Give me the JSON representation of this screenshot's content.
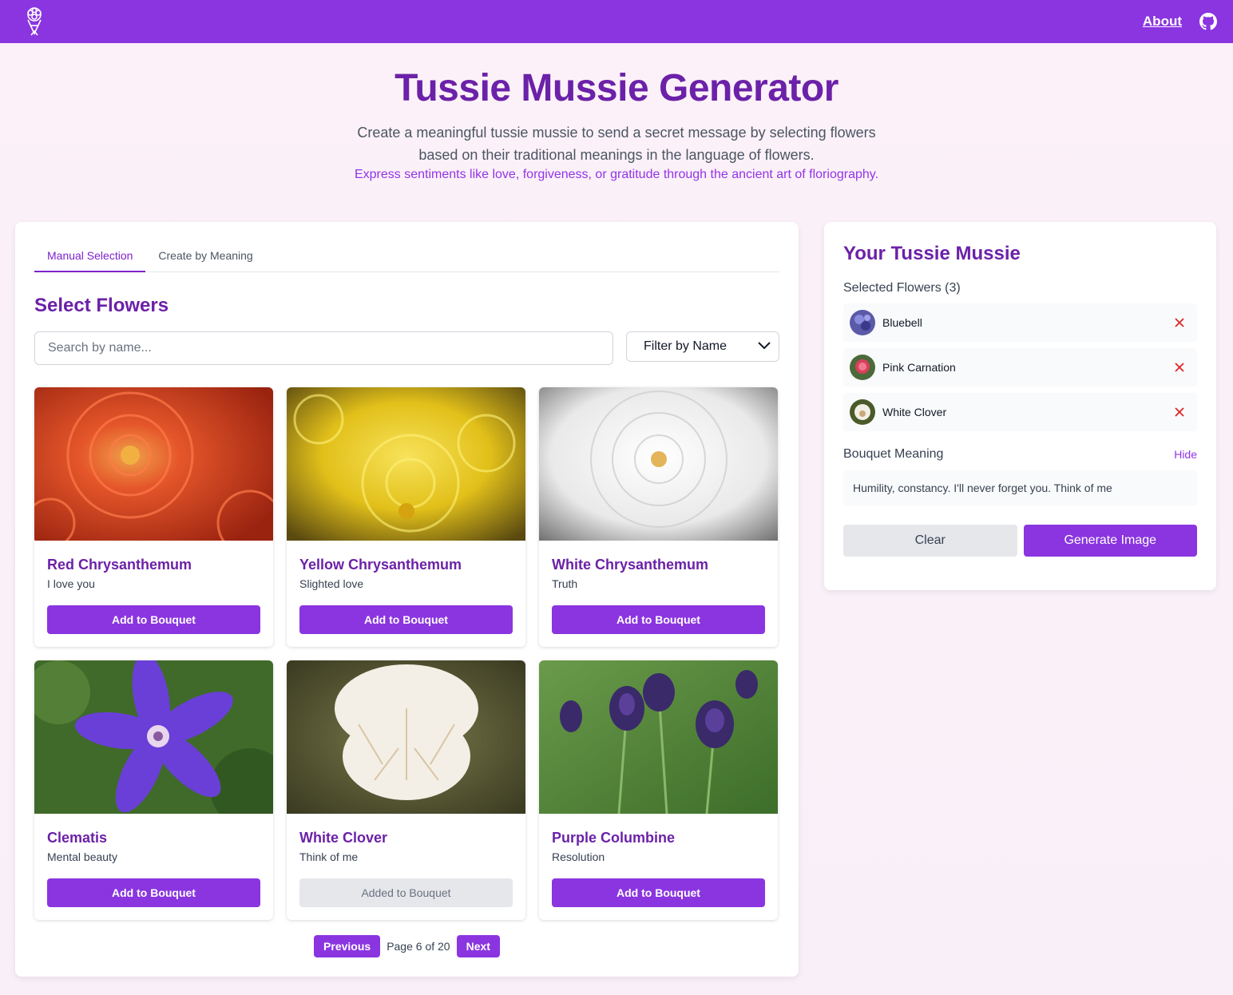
{
  "header": {
    "about_label": "About",
    "logo_icon": "bouquet-icon",
    "github_icon": "github-icon",
    "brand_color": "#8a35e0"
  },
  "hero": {
    "title": "Tussie Mussie Generator",
    "description": "Create a meaningful tussie mussie to send a secret message by selecting flowers based on their traditional meanings in the language of flowers.",
    "tagline": "Express sentiments like love, forgiveness, or gratitude through the ancient art of floriography."
  },
  "tabs": [
    {
      "label": "Manual Selection",
      "active": true
    },
    {
      "label": "Create by Meaning",
      "active": false
    }
  ],
  "selector": {
    "title": "Select Flowers",
    "search_placeholder": "Search by name...",
    "filter_label": "Filter by Name"
  },
  "flowers": [
    {
      "name": "Red Chrysanthemum",
      "meaning": "I love you",
      "button": "Add to Bouquet",
      "added": false,
      "image": "red-chrysanthemum-photo"
    },
    {
      "name": "Yellow Chrysanthemum",
      "meaning": "Slighted love",
      "button": "Add to Bouquet",
      "added": false,
      "image": "yellow-chrysanthemum-photo"
    },
    {
      "name": "White Chrysanthemum",
      "meaning": "Truth",
      "button": "Add to Bouquet",
      "added": false,
      "image": "white-chrysanthemum-photo"
    },
    {
      "name": "Clematis",
      "meaning": "Mental beauty",
      "button": "Add to Bouquet",
      "added": false,
      "image": "clematis-photo"
    },
    {
      "name": "White Clover",
      "meaning": "Think of me",
      "button": "Added to Bouquet",
      "added": true,
      "image": "white-clover-photo"
    },
    {
      "name": "Purple Columbine",
      "meaning": "Resolution",
      "button": "Add to Bouquet",
      "added": false,
      "image": "purple-columbine-photo"
    }
  ],
  "pagination": {
    "previous_label": "Previous",
    "page_text": "Page 6 of 20",
    "next_label": "Next"
  },
  "bouquet": {
    "title": "Your Tussie Mussie",
    "selected_label": "Selected Flowers (3)",
    "selected": [
      {
        "name": "Bluebell",
        "thumb": "bluebell-thumb"
      },
      {
        "name": "Pink Carnation",
        "thumb": "pink-carnation-thumb"
      },
      {
        "name": "White Clover",
        "thumb": "white-clover-thumb"
      }
    ],
    "meaning_label": "Bouquet Meaning",
    "hide_label": "Hide",
    "meaning_text": "Humility, constancy. I'll never forget you. Think of me",
    "clear_label": "Clear",
    "generate_label": "Generate Image"
  }
}
